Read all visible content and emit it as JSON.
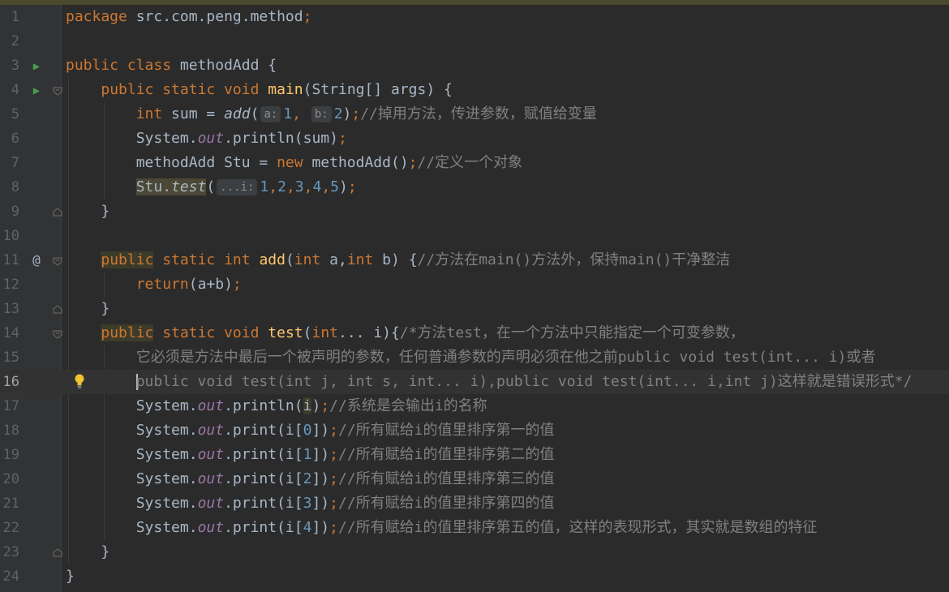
{
  "editor": {
    "line_numbers": [
      "1",
      "2",
      "3",
      "4",
      "5",
      "6",
      "7",
      "8",
      "9",
      "10",
      "11",
      "12",
      "13",
      "14",
      "15",
      "16",
      "17",
      "18",
      "19",
      "20",
      "21",
      "22",
      "23",
      "24"
    ],
    "current_line": "16",
    "gutter_marks": {
      "override": "@"
    },
    "hints": {
      "a": "a:",
      "b": "b:",
      "vararg": "...i:"
    },
    "code": {
      "l1": {
        "kw": "package",
        "rest": " src.com.peng.method",
        "semi": ";"
      },
      "l3": {
        "kw": "public class",
        "rest": " methodAdd {"
      },
      "l4": {
        "kw": "public static void",
        "name": "main",
        "rest": "(String[] args) {"
      },
      "l5": {
        "kw": "int",
        "pre": " sum = ",
        "call": "add",
        "open": "(",
        "n1": "1",
        "comma": ",",
        "n2": "2",
        "close": ")",
        "semi": ";",
        "comment": "//掉用方法，传进参数，赋值给变量"
      },
      "l6": {
        "pre": "System.",
        "field": "out",
        "post": ".println(sum)",
        "semi": ";"
      },
      "l7": {
        "pre": "methodAdd Stu = ",
        "kw": "new",
        "post": " methodAdd()",
        "semi": ";",
        "comment": "//定义一个对象"
      },
      "l8": {
        "obj": "Stu.",
        "call": "test",
        "open": "(",
        "n1": "1",
        "n2": "2",
        "n3": "3",
        "n4": "4",
        "n5": "5",
        "comma": ",",
        "close": ")",
        "semi": ";"
      },
      "l9": {
        "text": "}"
      },
      "l11": {
        "kw1": "public",
        "kw2": " static int ",
        "name": "add",
        "p1": "(",
        "kwint": "int",
        "p2": " a,",
        "p3": " b) {",
        "comment": "//方法在main()方法外，保持main()干净整洁"
      },
      "l12": {
        "kw": "return",
        "post": "(a+b)",
        "semi": ";"
      },
      "l13": {
        "text": "}"
      },
      "l14": {
        "kw1": "public",
        "kw2": " static void ",
        "name": "test",
        "p1": "(",
        "kwint": "int",
        "p2": "... i){",
        "comment": "/*方法test，在一个方法中只能指定一个可变参数，"
      },
      "l15": {
        "comment": "它必须是方法中最后一个被声明的参数，任何普通参数的声明必须在他之前public void test(int... i)或者"
      },
      "l16": {
        "comment": "public void test(int j, int s, int... i),public void test(int... i,int j)这样就是错误形式*/"
      },
      "l17": {
        "pre": "System.",
        "field": "out",
        "post": ".println(",
        "var": "i",
        "close": ")",
        "semi": ";",
        "comment": "//系统是会输出i的名称"
      },
      "l18": {
        "pre": "System.",
        "field": "out",
        "post": ".print(i[",
        "idx": "0",
        "close": "])",
        "semi": ";",
        "comment": "//所有赋给i的值里排序第一的值"
      },
      "l19": {
        "pre": "System.",
        "field": "out",
        "post": ".print(i[",
        "idx": "1",
        "close": "])",
        "semi": ";",
        "comment": "//所有赋给i的值里排序第二的值"
      },
      "l20": {
        "pre": "System.",
        "field": "out",
        "post": ".print(i[",
        "idx": "2",
        "close": "])",
        "semi": ";",
        "comment": "//所有赋给i的值里排序第三的值"
      },
      "l21": {
        "pre": "System.",
        "field": "out",
        "post": ".print(i[",
        "idx": "3",
        "close": "])",
        "semi": ";",
        "comment": "//所有赋给i的值里排序第四的值"
      },
      "l22": {
        "pre": "System.",
        "field": "out",
        "post": ".print(i[",
        "idx": "4",
        "close": "])",
        "semi": ";",
        "comment": "//所有赋给i的值里排序第五的值，这样的表现形式，其实就是数组的特征"
      },
      "l23": {
        "text": "}"
      },
      "l24": {
        "text": "}"
      }
    }
  }
}
